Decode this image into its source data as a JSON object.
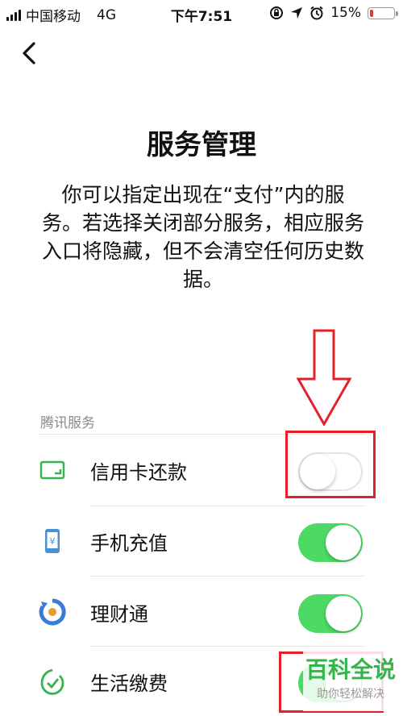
{
  "status_bar": {
    "carrier": "中国移动",
    "network": "4G",
    "time": "下午7:51",
    "battery_percent": "15%",
    "battery_level": 0.15,
    "battery_color": "#e53935"
  },
  "header": {
    "title": "服务管理"
  },
  "description": "你可以指定出现在“支付”内的服务。若选择关闭部分服务，相应服务入口将隐藏，但不会清空任何历史数据。",
  "section": {
    "label": "腾讯服务"
  },
  "services": [
    {
      "label": "信用卡还款",
      "icon": "credit-card-icon",
      "enabled": false
    },
    {
      "label": "手机充值",
      "icon": "phone-recharge-icon",
      "enabled": true
    },
    {
      "label": "理财通",
      "icon": "wealth-icon",
      "enabled": true
    },
    {
      "label": "生活缴费",
      "icon": "utility-payment-icon",
      "enabled": true
    }
  ],
  "watermark": {
    "title": "百科全说",
    "subtitle": "助你轻松解决"
  },
  "colors": {
    "toggle_on": "#4cd964",
    "annotation_red": "#e5202a",
    "brand_green": "#37b24d"
  }
}
